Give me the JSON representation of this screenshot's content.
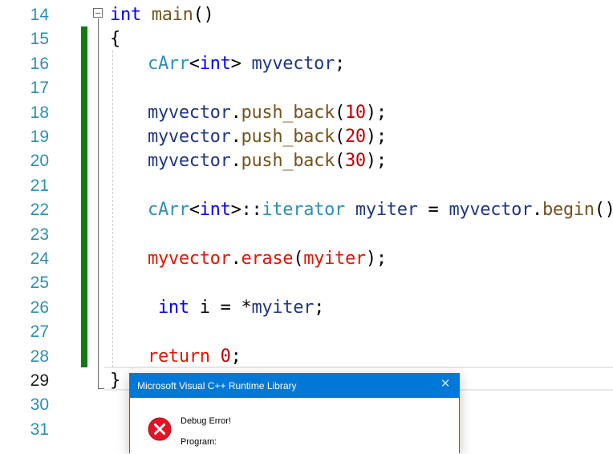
{
  "editor": {
    "lines": [
      {
        "num": "14",
        "code": [
          {
            "t": "int",
            "c": "kw"
          },
          {
            "t": " main",
            "c": "fn"
          },
          {
            "t": "()",
            "c": "punc"
          }
        ]
      },
      {
        "num": "15",
        "code": [
          {
            "t": "{",
            "c": "punc"
          }
        ]
      },
      {
        "num": "16",
        "indent": true,
        "code": [
          {
            "t": "cArr",
            "c": "type"
          },
          {
            "t": "<",
            "c": "punc"
          },
          {
            "t": "int",
            "c": "kw"
          },
          {
            "t": "> ",
            "c": "punc"
          },
          {
            "t": "myvector",
            "c": "var"
          },
          {
            "t": ";",
            "c": "punc"
          }
        ]
      },
      {
        "num": "17",
        "code": []
      },
      {
        "num": "18",
        "indent": true,
        "code": [
          {
            "t": "myvector",
            "c": "var"
          },
          {
            "t": ".",
            "c": "punc"
          },
          {
            "t": "push_back",
            "c": "fn"
          },
          {
            "t": "(",
            "c": "punc"
          },
          {
            "t": "10",
            "c": "num"
          },
          {
            "t": ");",
            "c": "punc"
          }
        ]
      },
      {
        "num": "19",
        "indent": true,
        "code": [
          {
            "t": "myvector",
            "c": "var"
          },
          {
            "t": ".",
            "c": "punc"
          },
          {
            "t": "push_back",
            "c": "fn"
          },
          {
            "t": "(",
            "c": "punc"
          },
          {
            "t": "20",
            "c": "num"
          },
          {
            "t": ");",
            "c": "punc"
          }
        ]
      },
      {
        "num": "20",
        "indent": true,
        "code": [
          {
            "t": "myvector",
            "c": "var"
          },
          {
            "t": ".",
            "c": "punc"
          },
          {
            "t": "push_back",
            "c": "fn"
          },
          {
            "t": "(",
            "c": "punc"
          },
          {
            "t": "30",
            "c": "num"
          },
          {
            "t": ");",
            "c": "punc"
          }
        ]
      },
      {
        "num": "21",
        "code": []
      },
      {
        "num": "22",
        "indent": true,
        "code": [
          {
            "t": "cArr",
            "c": "type"
          },
          {
            "t": "<",
            "c": "punc"
          },
          {
            "t": "int",
            "c": "kw"
          },
          {
            "t": ">::",
            "c": "punc"
          },
          {
            "t": "iterator",
            "c": "type"
          },
          {
            "t": " myiter",
            "c": "var"
          },
          {
            "t": " = ",
            "c": "punc"
          },
          {
            "t": "myvector",
            "c": "var"
          },
          {
            "t": ".",
            "c": "punc"
          },
          {
            "t": "begin",
            "c": "fn"
          },
          {
            "t": "();",
            "c": "punc"
          }
        ]
      },
      {
        "num": "23",
        "code": []
      },
      {
        "num": "24",
        "indent": true,
        "code": [
          {
            "t": "myvector",
            "c": "err"
          },
          {
            "t": ".",
            "c": "punc"
          },
          {
            "t": "erase",
            "c": "err"
          },
          {
            "t": "(",
            "c": "punc"
          },
          {
            "t": "myiter",
            "c": "err"
          },
          {
            "t": ");",
            "c": "punc"
          }
        ]
      },
      {
        "num": "25",
        "code": []
      },
      {
        "num": "26",
        "indent": true,
        "code": [
          {
            "t": " int",
            "c": "kw"
          },
          {
            "t": " i = *",
            "c": "punc"
          },
          {
            "t": "myiter",
            "c": "var"
          },
          {
            "t": ";",
            "c": "punc"
          }
        ]
      },
      {
        "num": "27",
        "code": []
      },
      {
        "num": "28",
        "indent": true,
        "code": [
          {
            "t": "return",
            "c": "err"
          },
          {
            "t": " ",
            "c": "punc"
          },
          {
            "t": "0",
            "c": "num"
          },
          {
            "t": ";",
            "c": "punc"
          }
        ]
      },
      {
        "num": "29",
        "current": true,
        "code": [
          {
            "t": "}",
            "c": "punc"
          }
        ]
      },
      {
        "num": "30",
        "code": []
      },
      {
        "num": "31",
        "code": []
      }
    ]
  },
  "dialog": {
    "title": "Microsoft Visual C++ Runtime Library",
    "close_glyph": "✕",
    "message": "Debug Error!",
    "program_label": "Program:"
  },
  "colors": {
    "keyword": "#0000ff",
    "type": "#2b91af",
    "function": "#74531f",
    "variable": "#1f377f",
    "number": "#c00000",
    "error_highlight": "#e51400",
    "change_bar": "#107c10",
    "dialog_accent": "#0078d7",
    "error_icon": "#e81123"
  }
}
